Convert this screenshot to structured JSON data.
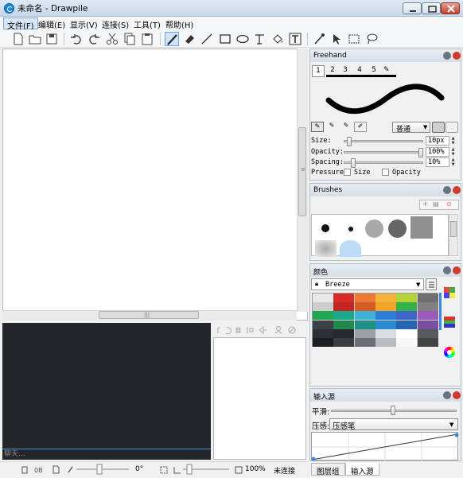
{
  "window": {
    "title": "未命名 - Drawpile"
  },
  "menu": [
    "文件(F)",
    "编辑(E)",
    "显示(V)",
    "连接(S)",
    "工具(T)",
    "帮助(H)"
  ],
  "freehand": {
    "title": "Freehand",
    "presets": [
      "1",
      "2",
      "3",
      "4",
      "5"
    ],
    "blend_mode": "普通",
    "size_label": "Size:",
    "size_value": "10px",
    "size_fraction": 0.04,
    "opacity_label": "Opacity:",
    "opacity_value": "100%",
    "opacity_fraction": 1.0,
    "spacing_label": "Spacing:",
    "spacing_value": "10%",
    "spacing_fraction": 0.1,
    "pressure_label": "Pressure:",
    "pressure_size": "Size",
    "pressure_opacity": "Opacity"
  },
  "brushes": {
    "title": "Brushes"
  },
  "colors": {
    "title": "颜色",
    "palette_name": "Breeze",
    "swatches": [
      [
        "#e8e8e8",
        "#d62e27",
        "#ec7a35",
        "#f4b43b",
        "#b4d33a",
        "#6f6f6f"
      ],
      [
        "#cdcdcd",
        "#c42520",
        "#d45b21",
        "#f3a528",
        "#34b24a",
        "#808080"
      ],
      [
        "#1fa851",
        "#1aa78a",
        "#3fb3d6",
        "#2f7fd8",
        "#3d66c4",
        "#9c5ab8"
      ],
      [
        "#3c4147",
        "#1f8a4c",
        "#1f8f86",
        "#2a8ad1",
        "#2565b0",
        "#7a4e9e"
      ],
      [
        "#2c2f33",
        "#26292d",
        "#9aa0a6",
        "#dadce0",
        "#ffffff",
        "#555a60"
      ],
      [
        "#1b1d20",
        "#393c40",
        "#6b7076",
        "#b8bcc0",
        "#f8f8f8",
        "#444"
      ]
    ]
  },
  "input": {
    "title": "输入源",
    "smoothing_label": "平滑:",
    "pressure_label": "压感:",
    "pressure_value": "压感笔"
  },
  "tabs": [
    "图层组",
    "输入源"
  ],
  "chat": {
    "placeholder": "聊天..."
  },
  "status": {
    "rotation": "0°",
    "zoom": "100%",
    "connection": "未连接"
  }
}
